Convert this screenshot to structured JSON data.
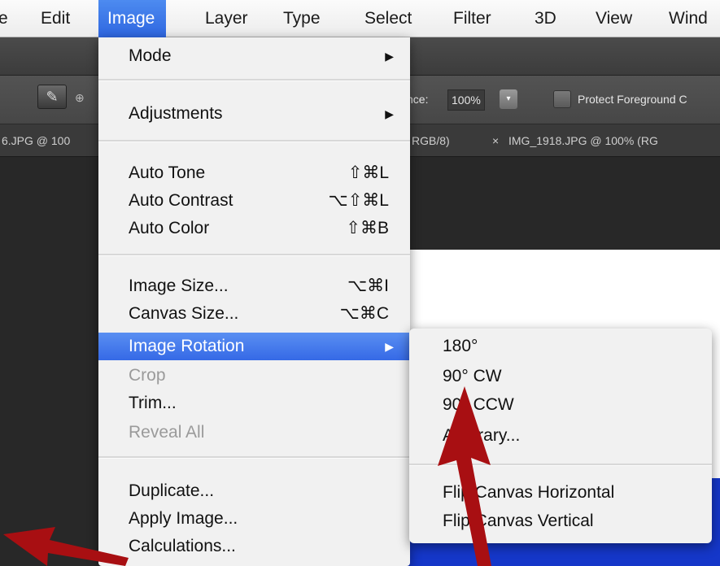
{
  "menubar": {
    "items": [
      "e",
      "Edit",
      "Image",
      "Layer",
      "Type",
      "Select",
      "Filter",
      "3D",
      "View",
      "Wind"
    ]
  },
  "options_bar": {
    "tolerance_label": "nce:",
    "tolerance_value": "100%",
    "dropdown_glyph": "▾",
    "protect_label": "Protect Foreground C"
  },
  "tabs": {
    "tab1": "6.JPG @ 100",
    "tab2": "RGB/8)",
    "tab3_close": "×",
    "tab3": "IMG_1918.JPG @ 100% (RG"
  },
  "image_menu": {
    "mode": "Mode",
    "adjustments": "Adjustments",
    "auto_tone": "Auto Tone",
    "auto_tone_sc": "⇧⌘L",
    "auto_contrast": "Auto Contrast",
    "auto_contrast_sc": "⌥⇧⌘L",
    "auto_color": "Auto Color",
    "auto_color_sc": "⇧⌘B",
    "image_size": "Image Size...",
    "image_size_sc": "⌥⌘I",
    "canvas_size": "Canvas Size...",
    "canvas_size_sc": "⌥⌘C",
    "image_rotation": "Image Rotation",
    "crop": "Crop",
    "trim": "Trim...",
    "reveal_all": "Reveal All",
    "duplicate": "Duplicate...",
    "apply_image": "Apply Image...",
    "calculations": "Calculations...",
    "submenu_arrow": "▶"
  },
  "rotation_submenu": {
    "r180": "180°",
    "r90cw": "90° CW",
    "r90ccw": "90° CCW",
    "arbitrary": "Arbitrary...",
    "flip_h": "Flip Canvas Horizontal",
    "flip_v": "Flip Canvas Vertical"
  },
  "colors": {
    "highlight": "#3a6fe8",
    "arrow": "#a80f12",
    "canvas_blue": "#1537c9"
  }
}
